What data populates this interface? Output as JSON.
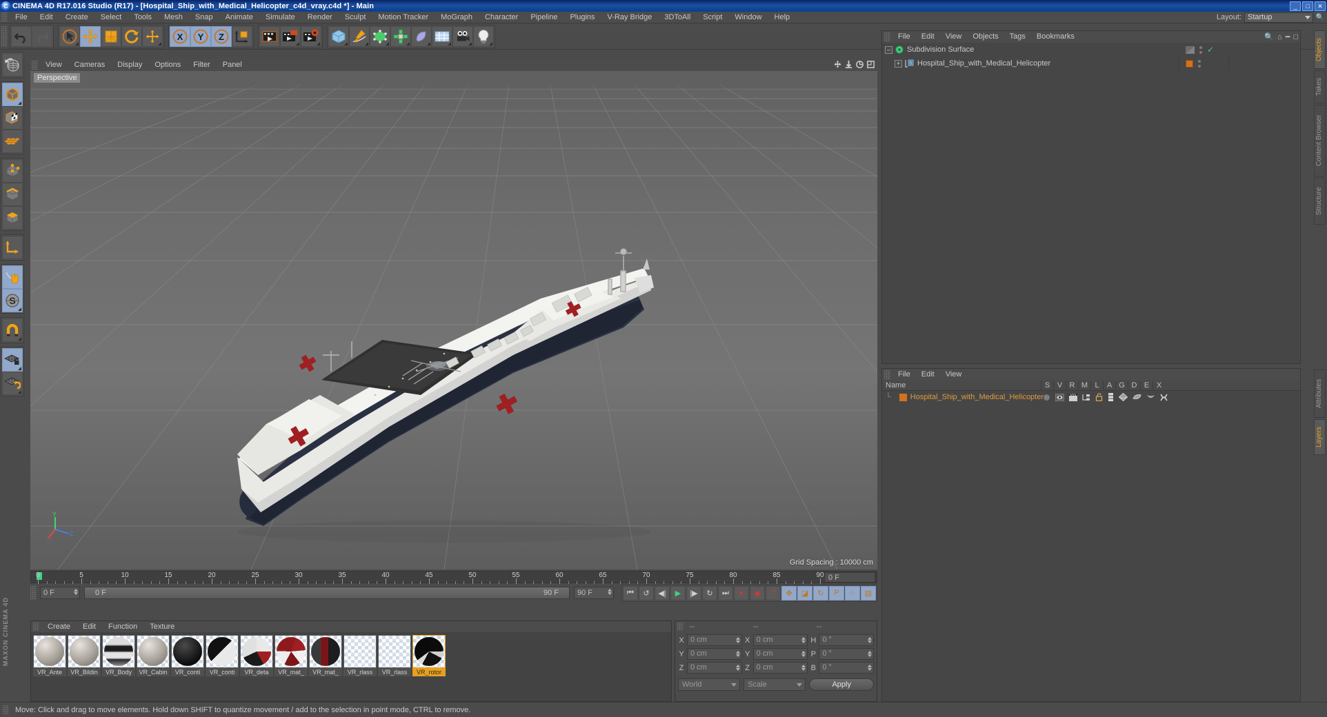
{
  "window": {
    "title": "CINEMA 4D R17.016 Studio (R17) - [Hospital_Ship_with_Medical_Helicopter_c4d_vray.c4d *] - Main",
    "app_icon": "c4d-logo-icon",
    "minimize": "_",
    "maximize": "□",
    "close": "✕"
  },
  "menubar": {
    "items": [
      "File",
      "Edit",
      "Create",
      "Select",
      "Tools",
      "Mesh",
      "Snap",
      "Animate",
      "Simulate",
      "Render",
      "Sculpt",
      "Motion Tracker",
      "MoGraph",
      "Character",
      "Pipeline",
      "Plugins",
      "V-Ray Bridge",
      "3DToAll",
      "Script",
      "Window",
      "Help"
    ],
    "layout_label": "Layout:",
    "layout_value": "Startup",
    "search_icon": "magnifier-icon"
  },
  "toolbar": {
    "undo": "undo-arrow-icon",
    "redo": "redo-arrow-icon",
    "select": "live-selection-icon",
    "move": "move-tool-icon",
    "scale": "scale-tool-icon",
    "rotate": "rotate-tool-icon",
    "move2": "move-axis-icon",
    "axis_x": "X",
    "axis_y": "Y",
    "axis_z": "Z",
    "world_axis": "world-object-axis-icon",
    "render_view": "render-view-icon",
    "render_region": "render-region-icon",
    "render_settings": "render-settings-icon",
    "primitive": "cube-primitive-icon",
    "spline": "pen-spline-icon",
    "generator": "generator-icon",
    "deformer": "deformer-icon",
    "scene_obj": "scene-object-icon",
    "environment": "environment-icon",
    "camera": "camera-icon",
    "light": "light-icon"
  },
  "lefttoolbar": {
    "items": [
      {
        "name": "undo-view-icon",
        "active": false
      },
      {
        "name": "editable-object-icon",
        "active": true
      },
      {
        "name": "model-mode-icon",
        "active": false
      },
      {
        "name": "texture-mode-icon",
        "active": false
      },
      {
        "name": "points-mode-icon",
        "active": false
      },
      {
        "name": "edges-mode-icon",
        "active": false
      },
      {
        "name": "polygons-mode-icon",
        "active": false
      },
      {
        "name": "axis-modify-icon",
        "active": false
      },
      {
        "name": "viewport-solo-icon",
        "active": true
      },
      {
        "name": "enable-axis-icon",
        "active": true
      },
      {
        "name": "snap-magnet-icon",
        "active": false
      },
      {
        "name": "workplane-lock-icon",
        "active": true
      },
      {
        "name": "workplane-rotate-icon",
        "active": false
      }
    ],
    "brand": "MAXON CINEMA 4D"
  },
  "viewport": {
    "menu": [
      "View",
      "Cameras",
      "Display",
      "Options",
      "Filter",
      "Panel"
    ],
    "label": "Perspective",
    "grid_spacing": "Grid Spacing : 10000 cm",
    "nav_icons": [
      "pan-icon",
      "zoom-icon",
      "rotate-view-icon",
      "maximize-view-icon"
    ],
    "axis": {
      "x": "X",
      "y": "Y",
      "z": "Z"
    },
    "scene": "hospital-ship-with-medical-helicopter-3d-model"
  },
  "timeline": {
    "ticks": [
      0,
      5,
      10,
      15,
      20,
      25,
      30,
      35,
      40,
      45,
      50,
      55,
      60,
      65,
      70,
      75,
      80,
      85,
      90
    ],
    "current_frame_label": "0 F",
    "start_field": "0 F",
    "range_start": "0 F",
    "range_end": "90 F",
    "end_field": "90 F",
    "playhead": 0
  },
  "animbar": {
    "buttons": [
      {
        "name": "go-to-start-button",
        "glyph": "⏮",
        "active": false
      },
      {
        "name": "previous-key-button",
        "glyph": "↺",
        "active": false
      },
      {
        "name": "previous-frame-button",
        "glyph": "◀|",
        "active": false
      },
      {
        "name": "play-button",
        "glyph": "▶",
        "active": false
      },
      {
        "name": "next-frame-button",
        "glyph": "|▶",
        "active": false
      },
      {
        "name": "next-key-button",
        "glyph": "↻",
        "active": false
      },
      {
        "name": "go-to-end-button",
        "glyph": "⏭",
        "active": false
      },
      {
        "name": "record-active-objects-button",
        "glyph": "⦿",
        "active": false
      },
      {
        "name": "autokeying-button",
        "glyph": "◉",
        "active": false
      },
      {
        "name": "keyframe-selection-button",
        "glyph": "?",
        "active": false
      },
      {
        "name": "position-key-button",
        "glyph": "✥",
        "active": true
      },
      {
        "name": "scale-key-button",
        "glyph": "◪",
        "active": true
      },
      {
        "name": "rotation-key-button",
        "glyph": "↻",
        "active": true
      },
      {
        "name": "param-key-button",
        "glyph": "P",
        "active": true
      },
      {
        "name": "point-level-anim-button",
        "glyph": "⁘",
        "active": true
      },
      {
        "name": "timeline-toggle-button",
        "glyph": "▤",
        "active": true
      }
    ]
  },
  "materials": {
    "menu": [
      "Create",
      "Edit",
      "Function",
      "Texture"
    ],
    "items": [
      {
        "name": "VR_Ante",
        "selected": false,
        "style": "stone"
      },
      {
        "name": "VR_Bildin",
        "selected": false,
        "style": "stone"
      },
      {
        "name": "VR_Body",
        "selected": false,
        "style": "body"
      },
      {
        "name": "VR_Cabin",
        "selected": false,
        "style": "stone"
      },
      {
        "name": "VR_conti",
        "selected": false,
        "style": "dark"
      },
      {
        "name": "VR_conti",
        "selected": false,
        "style": "split"
      },
      {
        "name": "VR_deta",
        "selected": false,
        "style": "redwhite"
      },
      {
        "name": "VR_mat_",
        "selected": false,
        "style": "redcheck"
      },
      {
        "name": "VR_mat_",
        "selected": false,
        "style": "darkred"
      },
      {
        "name": "VR_rlass",
        "selected": false,
        "style": "glass"
      },
      {
        "name": "VR_rlass",
        "selected": false,
        "style": "glass"
      },
      {
        "name": "VR_rotor",
        "selected": true,
        "style": "rotor"
      }
    ]
  },
  "coordinates": {
    "headers": [
      "--",
      "--",
      "--"
    ],
    "rows": [
      {
        "pos_label": "X",
        "pos_value": "0 cm",
        "size_label": "X",
        "size_value": "0 cm",
        "rot_label": "H",
        "rot_value": "0 °"
      },
      {
        "pos_label": "Y",
        "pos_value": "0 cm",
        "size_label": "Y",
        "size_value": "0 cm",
        "rot_label": "P",
        "rot_value": "0 °"
      },
      {
        "pos_label": "Z",
        "pos_value": "0 cm",
        "size_label": "Z",
        "size_value": "0 cm",
        "rot_label": "B",
        "rot_value": "0 °"
      }
    ],
    "coord_system": "World",
    "mode": "Scale",
    "apply": "Apply"
  },
  "object_manager": {
    "menu": [
      "File",
      "Edit",
      "View",
      "Objects",
      "Tags",
      "Bookmarks"
    ],
    "search_icon": "magnifier-icon",
    "home_icon": "home-icon",
    "rows": [
      {
        "name": "Subdivision Surface",
        "depth": 0,
        "icon": "subdivision-surface-icon",
        "expander": "-",
        "visibility": "half",
        "check": "✓",
        "tag": null
      },
      {
        "name": "Hospital_Ship_with_Medical_Helicopter",
        "depth": 1,
        "icon": "null-object-icon",
        "expander": "+",
        "visibility": null,
        "check": null,
        "tag": "material-tag"
      }
    ]
  },
  "layer_manager": {
    "menu": [
      "File",
      "Edit",
      "View"
    ],
    "columns": [
      "Name",
      "S",
      "V",
      "R",
      "M",
      "L",
      "A",
      "G",
      "D",
      "E",
      "X"
    ],
    "rows": [
      {
        "name": "Hospital_Ship_with_Medical_Helicopter",
        "color": "#d2721f"
      }
    ],
    "row_icons": [
      "solo-dot-icon",
      "visible-eye-icon",
      "render-clapper-icon",
      "manager-icon",
      "lock-open-icon",
      "animation-icon",
      "generator-icon",
      "deformer-icon",
      "expression-icon",
      "xref-icon"
    ]
  },
  "vtabs": {
    "top": [
      {
        "label": "Objects",
        "active": true
      },
      {
        "label": "Takes",
        "active": false
      },
      {
        "label": "Content Browser",
        "active": false
      },
      {
        "label": "Structure",
        "active": false
      }
    ],
    "bottom": [
      {
        "label": "Attributes",
        "active": false
      },
      {
        "label": "Layers",
        "active": true
      }
    ]
  },
  "statusbar": {
    "message": "Move: Click and drag to move elements. Hold down SHIFT to quantize movement / add to the selection in point mode, CTRL to remove."
  },
  "colors": {
    "accent_orange": "#e8a020",
    "tag_orange": "#d2721f",
    "selection_blue": "#91a8cb",
    "panel_bg": "#4b4b4b",
    "title_blue": "#0a3d8f",
    "green_key": "#41d18a",
    "red": "#b32020"
  }
}
